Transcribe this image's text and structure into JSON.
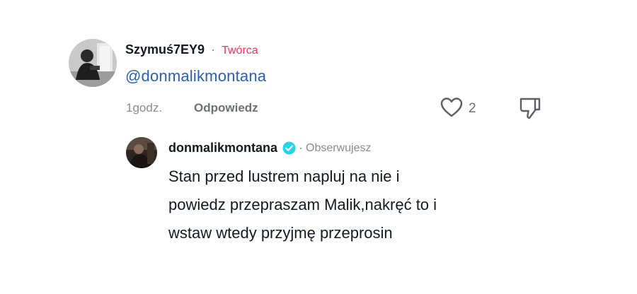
{
  "comment": {
    "username": "Szymuś7EY9",
    "separator": "·",
    "creator_label": "Twórca",
    "text": "@donmalikmontana",
    "time": "1godz.",
    "reply_label": "Odpowiedz",
    "like_count": "2",
    "icons": {
      "like": "heart-outline-icon",
      "dislike": "thumbs-down-icon"
    }
  },
  "reply": {
    "username": "donmalikmontana",
    "verified_icon": "verified-badge-icon",
    "separator": "·",
    "status": "Obserwujesz",
    "lines": [
      "Stan przed lustrem napluj na nie i",
      "powiedz przepraszam Malik,nakręć to i",
      "wstaw wtedy przyjmę przeprosin"
    ]
  },
  "colors": {
    "mention": "#2b5db9",
    "creator": "#fe2c55",
    "verified": "#20d5ec",
    "muted": "#8a8b91"
  }
}
